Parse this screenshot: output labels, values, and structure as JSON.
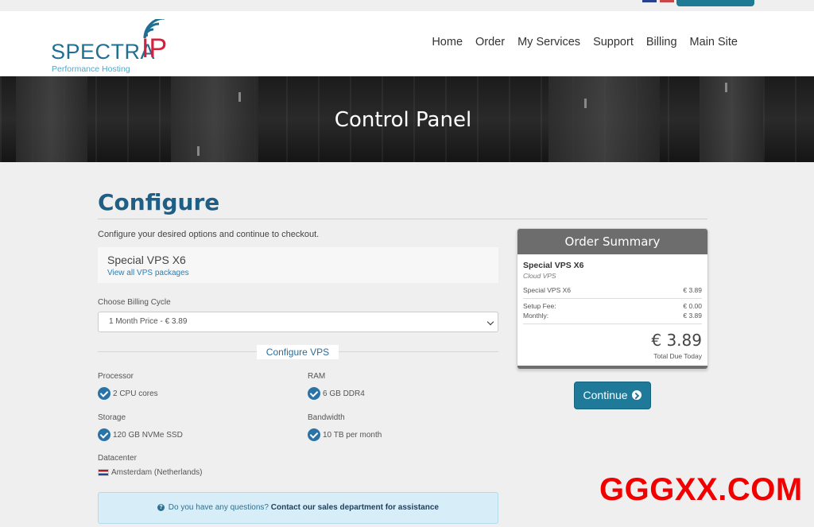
{
  "header": {
    "logo_name": "SPECTRA",
    "logo_suffix": "IP",
    "logo_tagline": "Performance Hosting",
    "nav": [
      {
        "label": "Home"
      },
      {
        "label": "Order"
      },
      {
        "label": "My Services"
      },
      {
        "label": "Support"
      },
      {
        "label": "Billing"
      },
      {
        "label": "Main Site"
      }
    ]
  },
  "banner": {
    "title": "Control Panel"
  },
  "main": {
    "title": "Configure",
    "intro": "Configure your desired options and continue to checkout.",
    "product": {
      "name": "Special VPS X6",
      "link": "View all VPS packages"
    },
    "billing": {
      "label": "Choose Billing Cycle",
      "selected": "1 Month Price - € 3.89"
    },
    "section_title": "Configure VPS",
    "specs": {
      "processor": {
        "label": "Processor",
        "value": "2 CPU cores"
      },
      "ram": {
        "label": "RAM",
        "value": "6 GB DDR4"
      },
      "storage": {
        "label": "Storage",
        "value": "120 GB NVMe SSD"
      },
      "bandwidth": {
        "label": "Bandwidth",
        "value": "10 TB per month"
      },
      "datacenter": {
        "label": "Datacenter",
        "value": "Amsterdam (Netherlands)"
      }
    },
    "question": {
      "text": "Do you have any questions?",
      "link": "Contact our sales department for assistance"
    }
  },
  "summary": {
    "title": "Order Summary",
    "product": "Special VPS X6",
    "group": "Cloud VPS",
    "line_item": {
      "label": "Special VPS X6",
      "value": "€ 3.89"
    },
    "setup_fee": {
      "label": "Setup Fee:",
      "value": "€ 0.00"
    },
    "monthly": {
      "label": "Monthly:",
      "value": "€ 3.89"
    },
    "total": "€ 3.89",
    "total_label": "Total Due Today",
    "continue_label": "Continue"
  },
  "watermark": "GGGXX.COM",
  "colors": {
    "brand_blue": "#1f6f93",
    "brand_red": "#d4213d",
    "accent": "#1f7a9a",
    "check": "#2a73a8",
    "watermark": "#f20000"
  }
}
